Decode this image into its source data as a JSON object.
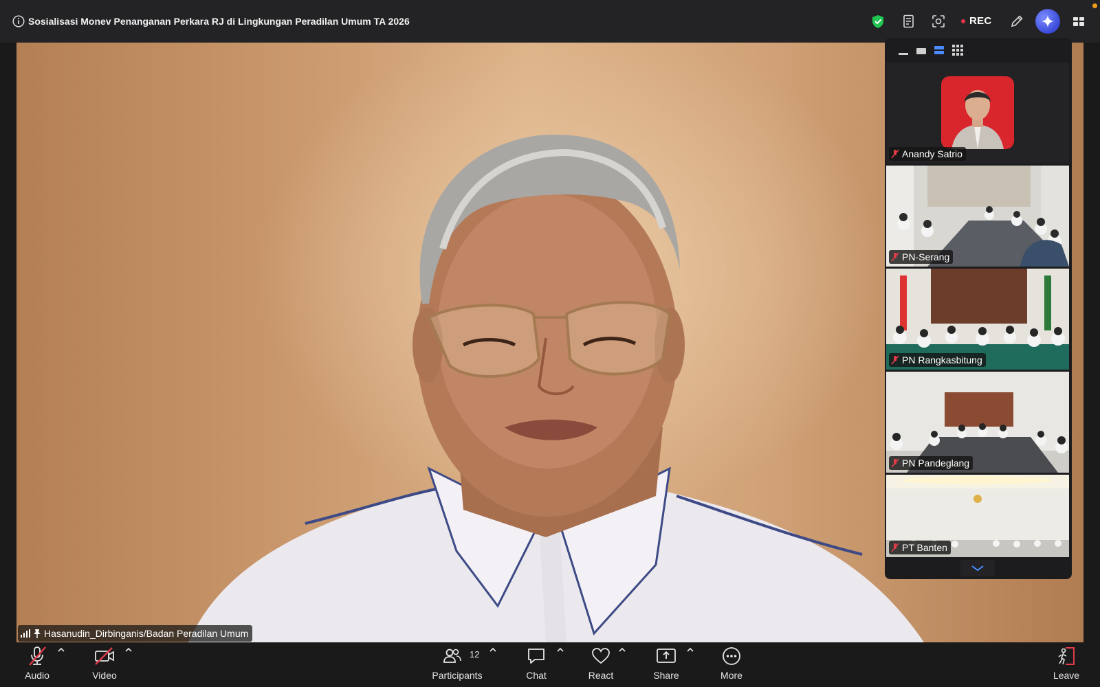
{
  "meeting": {
    "title": "Sosialisasi Monev Penanganan Perkara RJ di Lingkungan Peradilan Umum TA 2026",
    "recording_label": "REC"
  },
  "colors": {
    "topbar_bg": "#232325",
    "accent_blue": "#4a8cff",
    "shield_green": "#23c552",
    "mute_red": "#e23b4a",
    "rec_red": "#e8334a"
  },
  "topbar_icons": [
    "info-icon",
    "shield-check-icon",
    "notes-icon",
    "apps-icon",
    "record-dot",
    "pencil-icon",
    "ai-companion-icon",
    "view-grid-icon"
  ],
  "main_speaker": {
    "name": "Hasanudin_Dirbinganis/Badan Peradilan Umum",
    "icons": [
      "signal-bars-icon",
      "pin-icon"
    ]
  },
  "gallery": {
    "tiles": [
      {
        "name": "Anandy Satrio",
        "muted": true
      },
      {
        "name": "PN-Serang",
        "muted": true
      },
      {
        "name": "PN Rangkasbitung",
        "muted": true
      },
      {
        "name": "PN Pandeglang",
        "muted": true
      },
      {
        "name": "PT Banten",
        "muted": true
      }
    ]
  },
  "toolbar": {
    "audio_label": "Audio",
    "video_label": "Video",
    "participants_label": "Participants",
    "participants_count": "12",
    "chat_label": "Chat",
    "react_label": "React",
    "share_label": "Share",
    "more_label": "More",
    "leave_label": "Leave"
  }
}
